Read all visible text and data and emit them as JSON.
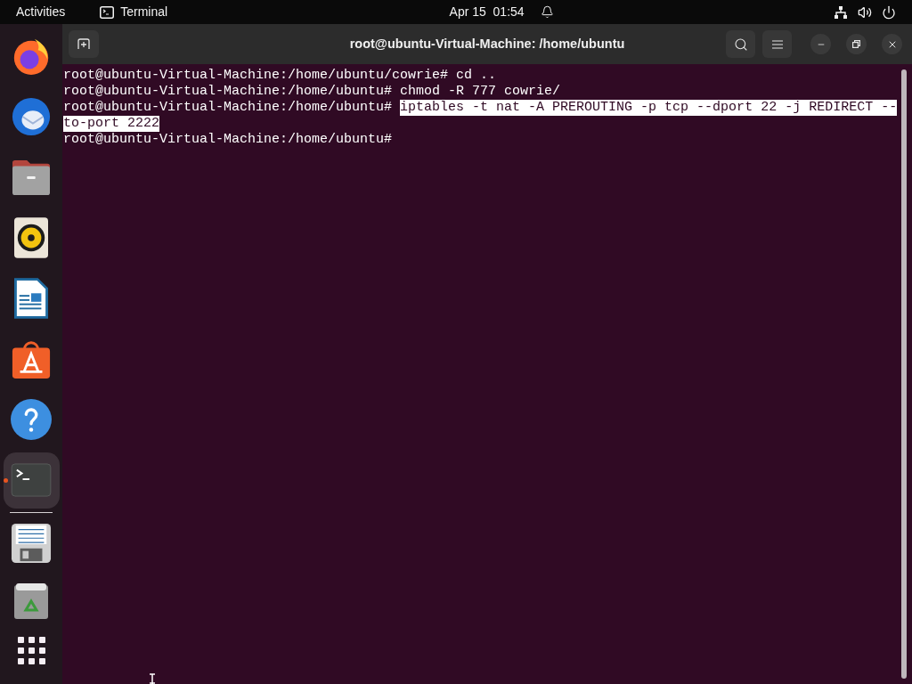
{
  "top_bar": {
    "activities": "Activities",
    "app_menu": "Terminal",
    "clock": "Apr 15  01:54"
  },
  "dock": {
    "apps": [
      {
        "kind": "browser",
        "running": false,
        "selected": false
      },
      {
        "kind": "mail",
        "running": false,
        "selected": false
      },
      {
        "kind": "files",
        "running": false,
        "selected": false
      },
      {
        "kind": "music",
        "running": false,
        "selected": false
      },
      {
        "kind": "document",
        "running": false,
        "selected": false
      },
      {
        "kind": "store",
        "running": false,
        "selected": false
      },
      {
        "kind": "help",
        "running": false,
        "selected": false
      },
      {
        "kind": "terminal",
        "running": true,
        "selected": true
      }
    ]
  },
  "window": {
    "title": "root@ubuntu-Virtual-Machine: /home/ubuntu"
  },
  "terminal": {
    "lines": [
      {
        "prompt": "root@ubuntu-Virtual-Machine:/home/ubuntu/cowrie#",
        "command": "cd ..",
        "selected": false
      },
      {
        "prompt": "root@ubuntu-Virtual-Machine:/home/ubuntu#",
        "command": "chmod -R 777 cowrie/",
        "selected": false
      },
      {
        "prompt": "root@ubuntu-Virtual-Machine:/home/ubuntu#",
        "command": "iptables -t nat -A PREROUTING -p tcp --dport 22 -j REDIRECT --",
        "selected": true
      },
      {
        "command": "to-port 2222",
        "selected": true
      },
      {
        "prompt": "root@ubuntu-Virtual-Machine:/home/ubuntu#"
      }
    ]
  }
}
